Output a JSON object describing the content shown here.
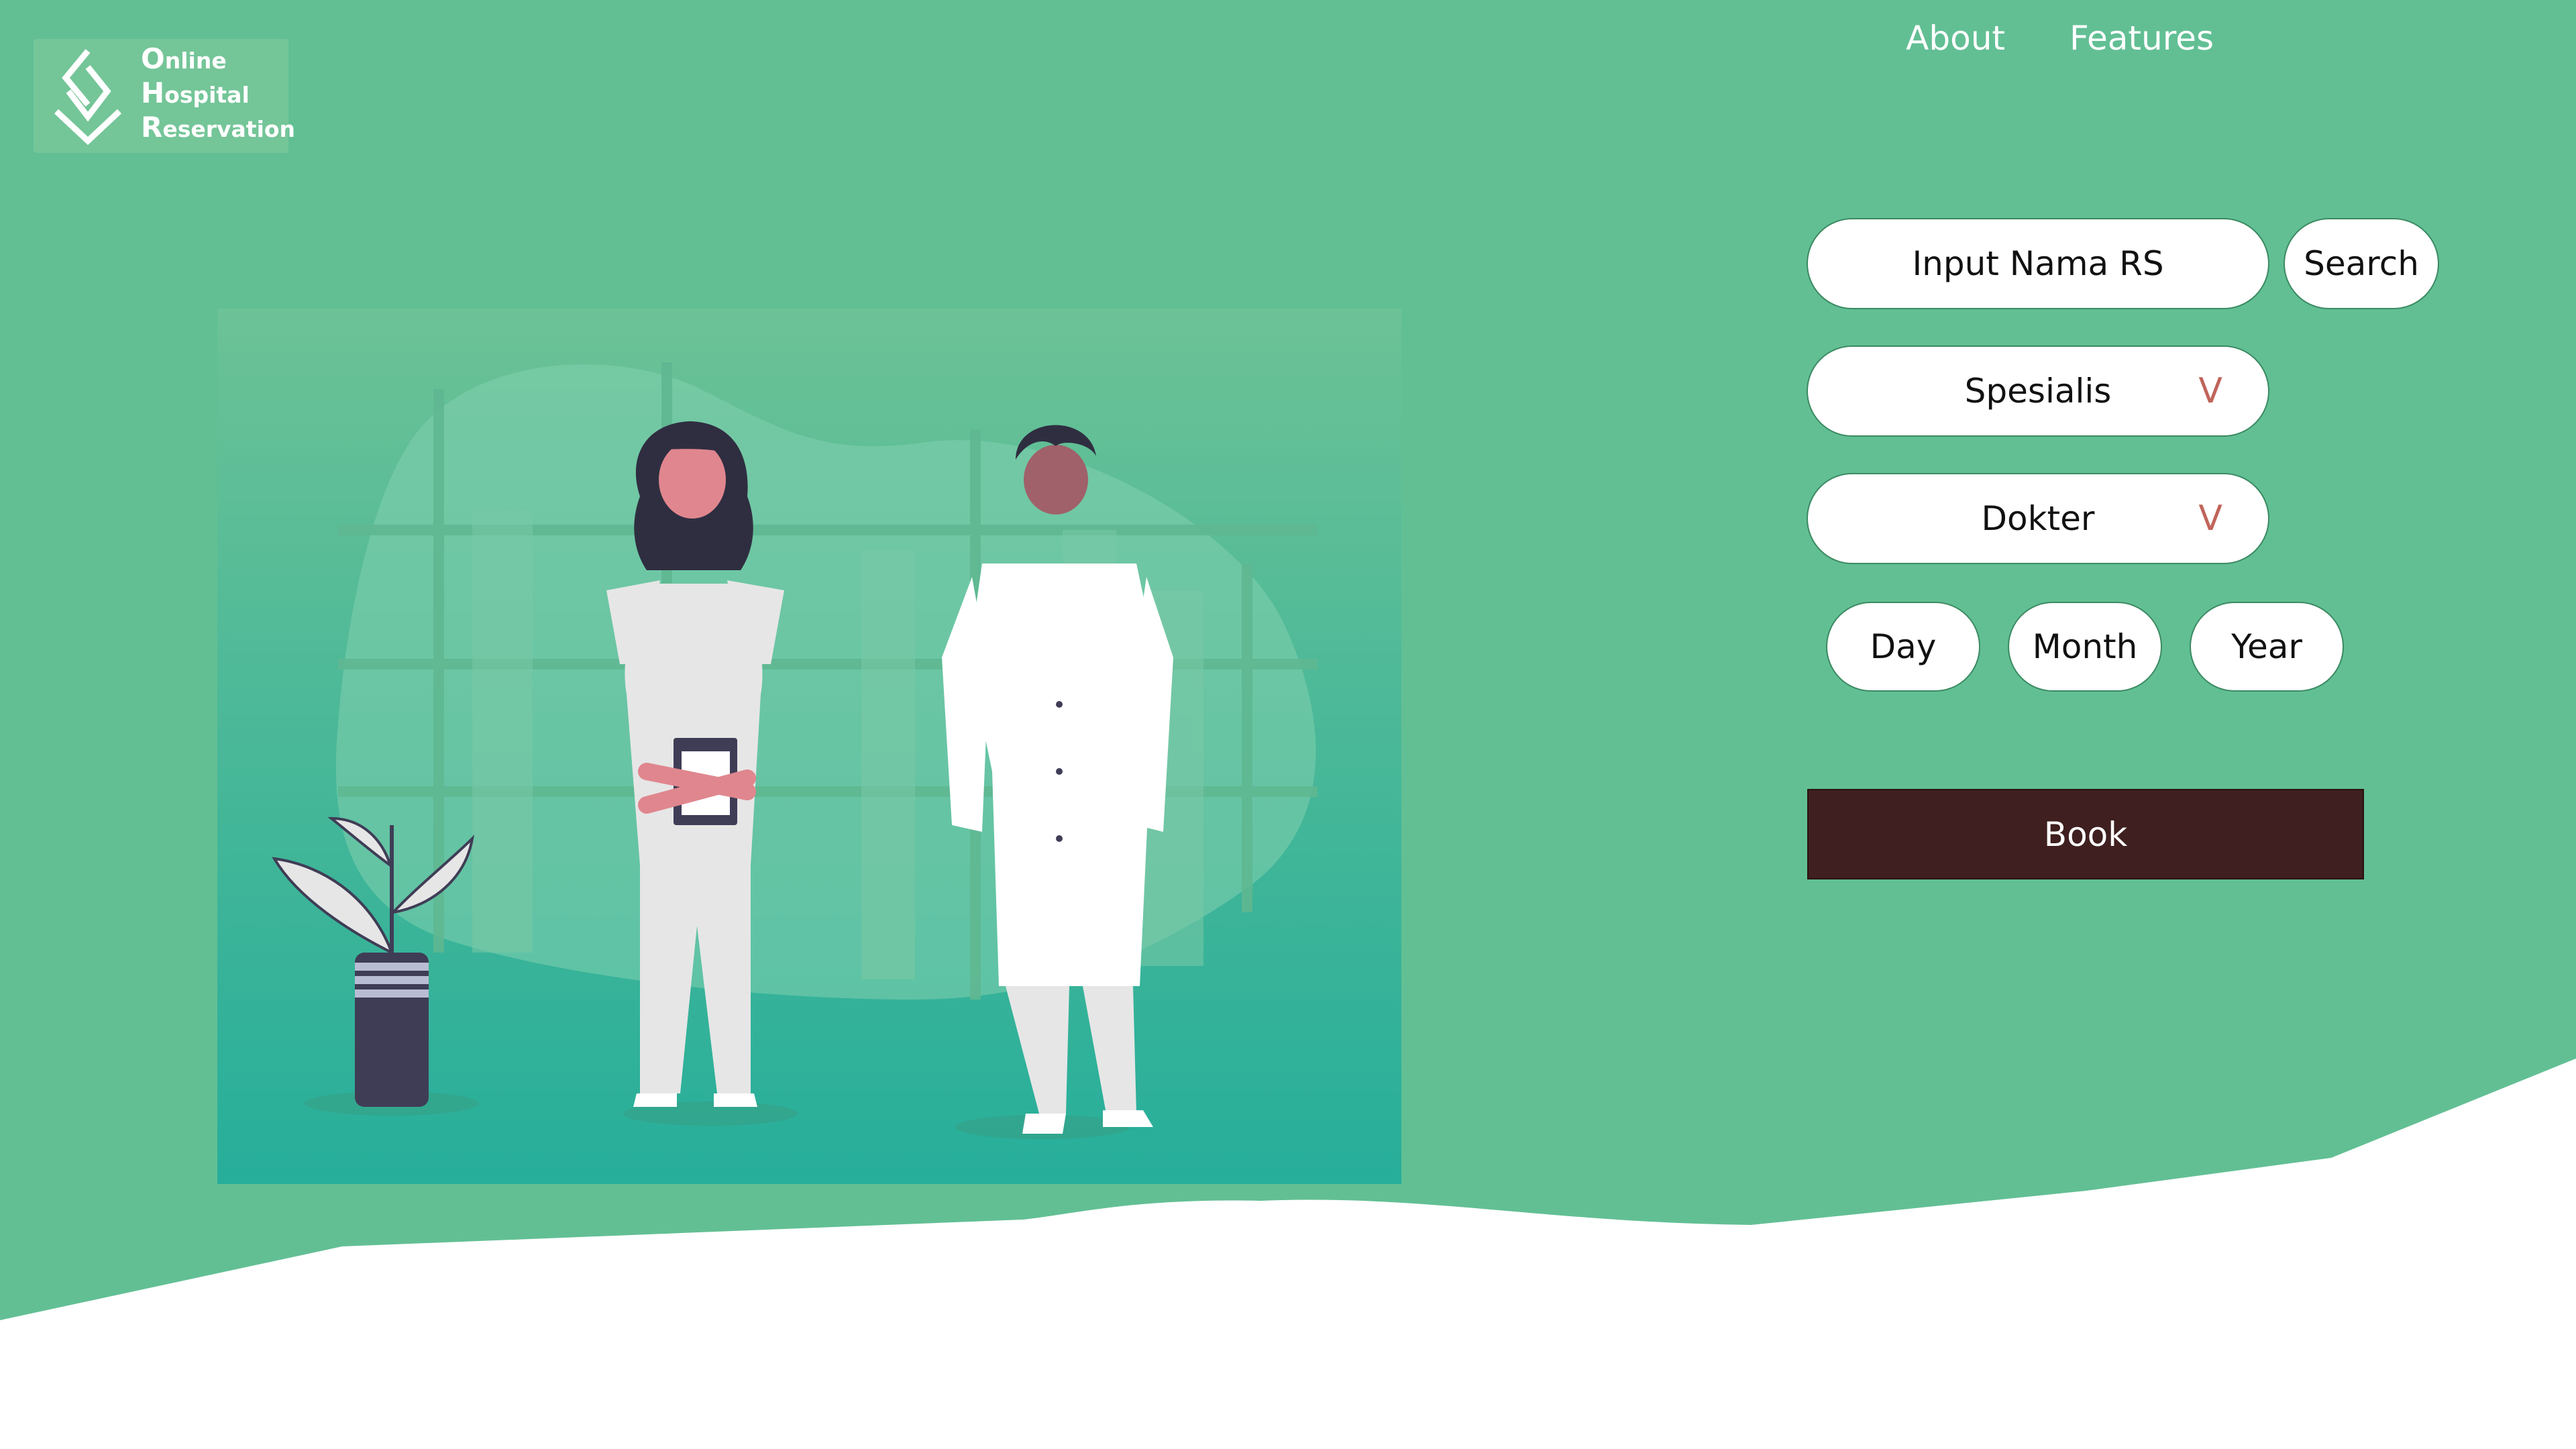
{
  "brand": {
    "logo_icon": "diamond-check-logo-icon",
    "line1_cap": "O",
    "line1_rest": "nline",
    "line2_cap": "H",
    "line2_rest": "ospital",
    "line3_cap": "R",
    "line3_rest": "eservation"
  },
  "nav": {
    "about": "About",
    "features": "Features"
  },
  "form": {
    "hospital_placeholder": "Input Nama RS",
    "search_label": "Search",
    "specialist_label": "Spesialis",
    "doctor_label": "Dokter",
    "chevron_glyph": "V",
    "day_label": "Day",
    "month_label": "Month",
    "year_label": "Year",
    "book_label": "Book"
  },
  "colors": {
    "background_green": "#62bf94",
    "book_button": "#3f1f1f",
    "chevron": "#c0645a"
  }
}
